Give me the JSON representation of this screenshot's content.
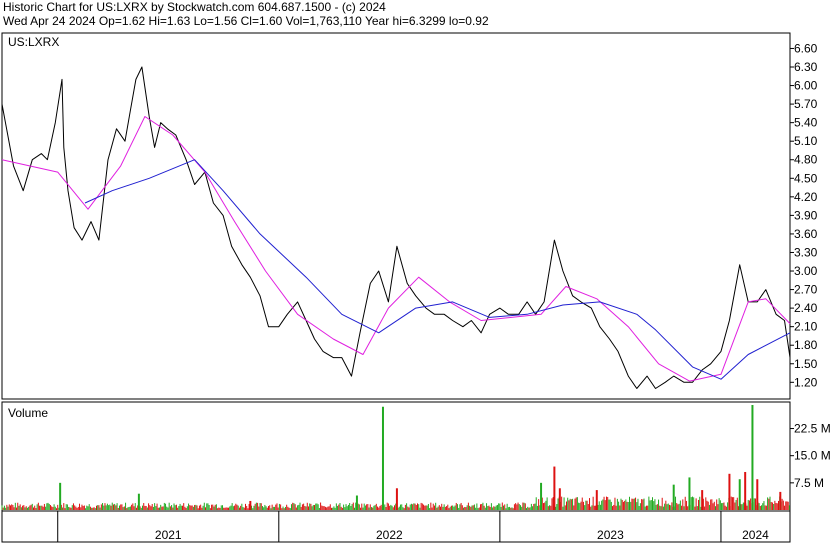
{
  "header": {
    "line1": "Historic Chart for US:LXRX by Stockwatch.com 604.687.1500 - (c) 2024",
    "line2": "Wed Apr 24 2024  Op=1.62  Hi=1.63  Lo=1.56  Cl=1.60  Vol=1,763,110  Year hi=6.3299  lo=0.92"
  },
  "colors": {
    "price": "#000000",
    "ma_short": "#e020e0",
    "ma_long": "#2020d0",
    "volume_up": "#22aa22",
    "volume_down": "#dd1111",
    "grid": "#000000"
  },
  "chart_data": [
    {
      "type": "line",
      "symbol_label": "US:LXRX",
      "y_ticks": [
        "6.60",
        "6.30",
        "6.00",
        "5.70",
        "5.40",
        "5.10",
        "4.80",
        "4.50",
        "4.20",
        "3.90",
        "3.60",
        "3.30",
        "3.00",
        "2.70",
        "2.40",
        "2.10",
        "1.80",
        "1.50",
        "1.20"
      ],
      "ylim": [
        0.93,
        6.85
      ],
      "x_tick_labels": [
        "2021",
        "2022",
        "2023",
        "2024"
      ],
      "x_range": [
        "2020-10-01",
        "2024-04-24"
      ],
      "x_year_boundaries": [
        "2021-01-01",
        "2022-01-01",
        "2023-01-01",
        "2024-01-01"
      ],
      "series": [
        {
          "role": "price",
          "x": [
            "2020-10-01",
            "2020-10-20",
            "2020-11-05",
            "2020-11-20",
            "2020-12-05",
            "2020-12-15",
            "2020-12-28",
            "2021-01-08",
            "2021-01-11",
            "2021-01-18",
            "2021-01-28",
            "2021-02-10",
            "2021-02-25",
            "2021-03-10",
            "2021-03-25",
            "2021-04-08",
            "2021-04-22",
            "2021-05-01",
            "2021-05-10",
            "2021-05-20",
            "2021-06-01",
            "2021-06-10",
            "2021-06-20",
            "2021-07-01",
            "2021-07-15",
            "2021-08-01",
            "2021-08-15",
            "2021-09-01",
            "2021-09-15",
            "2021-10-01",
            "2021-10-15",
            "2021-11-01",
            "2021-11-15",
            "2021-12-01",
            "2021-12-15",
            "2022-01-01",
            "2022-01-15",
            "2022-02-01",
            "2022-02-15",
            "2022-03-01",
            "2022-03-15",
            "2022-04-01",
            "2022-04-15",
            "2022-05-01",
            "2022-05-15",
            "2022-06-01",
            "2022-06-15",
            "2022-07-01",
            "2022-07-15",
            "2022-08-01",
            "2022-08-15",
            "2022-09-01",
            "2022-09-15",
            "2022-10-01",
            "2022-10-15",
            "2022-11-01",
            "2022-11-15",
            "2022-12-01",
            "2022-12-15",
            "2023-01-01",
            "2023-01-15",
            "2023-02-01",
            "2023-02-15",
            "2023-03-01",
            "2023-03-15",
            "2023-04-01",
            "2023-04-15",
            "2023-05-01",
            "2023-05-15",
            "2023-06-01",
            "2023-06-15",
            "2023-07-01",
            "2023-07-15",
            "2023-08-01",
            "2023-08-15",
            "2023-09-01",
            "2023-09-15",
            "2023-10-01",
            "2023-10-15",
            "2023-11-01",
            "2023-11-15",
            "2023-12-01",
            "2023-12-15",
            "2024-01-01",
            "2024-01-15",
            "2024-02-01",
            "2024-02-15",
            "2024-03-01",
            "2024-03-15",
            "2024-04-01",
            "2024-04-15",
            "2024-04-24"
          ],
          "values": [
            5.7,
            4.7,
            4.3,
            4.8,
            4.9,
            4.8,
            5.4,
            6.1,
            5.0,
            4.3,
            3.7,
            3.5,
            3.8,
            3.5,
            4.8,
            5.3,
            5.1,
            5.6,
            6.1,
            6.3,
            5.5,
            5.0,
            5.4,
            5.3,
            5.2,
            4.8,
            4.4,
            4.6,
            4.1,
            3.9,
            3.4,
            3.1,
            2.9,
            2.6,
            2.1,
            2.1,
            2.3,
            2.5,
            2.2,
            1.9,
            1.7,
            1.6,
            1.6,
            1.3,
            2.0,
            2.8,
            3.0,
            2.5,
            3.4,
            2.8,
            2.6,
            2.4,
            2.3,
            2.3,
            2.2,
            2.1,
            2.2,
            2.0,
            2.3,
            2.4,
            2.3,
            2.3,
            2.5,
            2.3,
            2.5,
            3.5,
            3.0,
            2.6,
            2.5,
            2.4,
            2.1,
            1.9,
            1.7,
            1.3,
            1.1,
            1.3,
            1.1,
            1.2,
            1.3,
            1.2,
            1.2,
            1.4,
            1.5,
            1.7,
            2.2,
            3.1,
            2.5,
            2.5,
            2.7,
            2.3,
            2.2,
            1.6
          ]
        },
        {
          "role": "moving-average-short",
          "x": [
            "2020-10-01",
            "2021-01-01",
            "2021-02-20",
            "2021-04-15",
            "2021-05-25",
            "2021-07-10",
            "2021-09-01",
            "2021-10-20",
            "2021-12-10",
            "2022-02-01",
            "2022-04-01",
            "2022-05-20",
            "2022-07-01",
            "2022-08-20",
            "2022-10-10",
            "2022-12-01",
            "2023-01-20",
            "2023-03-10",
            "2023-04-20",
            "2023-06-10",
            "2023-08-01",
            "2023-09-20",
            "2023-11-10",
            "2024-01-01",
            "2024-02-15",
            "2024-03-15",
            "2024-04-24"
          ],
          "values": [
            4.8,
            4.6,
            4.0,
            4.7,
            5.5,
            5.2,
            4.6,
            3.8,
            3.0,
            2.3,
            1.9,
            1.65,
            2.4,
            2.9,
            2.5,
            2.2,
            2.25,
            2.3,
            2.75,
            2.55,
            2.1,
            1.5,
            1.22,
            1.33,
            2.5,
            2.55,
            2.15
          ]
        },
        {
          "role": "moving-average-long",
          "x": [
            "2021-02-15",
            "2021-04-01",
            "2021-06-01",
            "2021-08-15",
            "2021-10-01",
            "2021-12-01",
            "2022-02-15",
            "2022-04-15",
            "2022-06-15",
            "2022-08-15",
            "2022-10-15",
            "2022-12-15",
            "2023-02-15",
            "2023-04-15",
            "2023-06-15",
            "2023-08-15",
            "2023-09-15",
            "2023-11-15",
            "2024-01-01",
            "2024-02-15",
            "2024-04-24"
          ],
          "values": [
            4.1,
            4.3,
            4.5,
            4.8,
            4.3,
            3.6,
            2.9,
            2.3,
            2.0,
            2.4,
            2.5,
            2.25,
            2.3,
            2.45,
            2.5,
            2.3,
            2.05,
            1.45,
            1.25,
            1.65,
            2.0
          ]
        }
      ]
    },
    {
      "type": "bar",
      "title": "Volume",
      "y_ticks": [
        "22.5 M",
        "15.0 M",
        "7.5 M"
      ],
      "ylim": [
        0,
        29
      ],
      "unit": "M",
      "x_range": [
        "2020-10-01",
        "2024-04-24"
      ],
      "spikes": [
        {
          "x": "2021-01-05",
          "value": 7.5,
          "dir": "up"
        },
        {
          "x": "2021-05-15",
          "value": 4.5,
          "dir": "up"
        },
        {
          "x": "2021-11-15",
          "value": 2.5,
          "dir": "down"
        },
        {
          "x": "2022-05-10",
          "value": 4.0,
          "dir": "up"
        },
        {
          "x": "2022-06-22",
          "value": 28.5,
          "dir": "up"
        },
        {
          "x": "2022-07-15",
          "value": 6.0,
          "dir": "down"
        },
        {
          "x": "2023-03-10",
          "value": 7.5,
          "dir": "up"
        },
        {
          "x": "2023-04-01",
          "value": 12.0,
          "dir": "down"
        },
        {
          "x": "2023-04-10",
          "value": 6.0,
          "dir": "down"
        },
        {
          "x": "2023-06-10",
          "value": 5.5,
          "dir": "down"
        },
        {
          "x": "2023-10-15",
          "value": 7.0,
          "dir": "up"
        },
        {
          "x": "2023-11-10",
          "value": 9.0,
          "dir": "up"
        },
        {
          "x": "2023-12-01",
          "value": 5.5,
          "dir": "down"
        },
        {
          "x": "2024-01-15",
          "value": 10.0,
          "dir": "down"
        },
        {
          "x": "2024-02-01",
          "value": 8.5,
          "dir": "up"
        },
        {
          "x": "2024-02-10",
          "value": 10.5,
          "dir": "down"
        },
        {
          "x": "2024-02-22",
          "value": 29.0,
          "dir": "up"
        },
        {
          "x": "2024-03-01",
          "value": 8.5,
          "dir": "down"
        },
        {
          "x": "2024-04-08",
          "value": 5.0,
          "dir": "down"
        }
      ],
      "baseline_volume": 1.6
    }
  ]
}
